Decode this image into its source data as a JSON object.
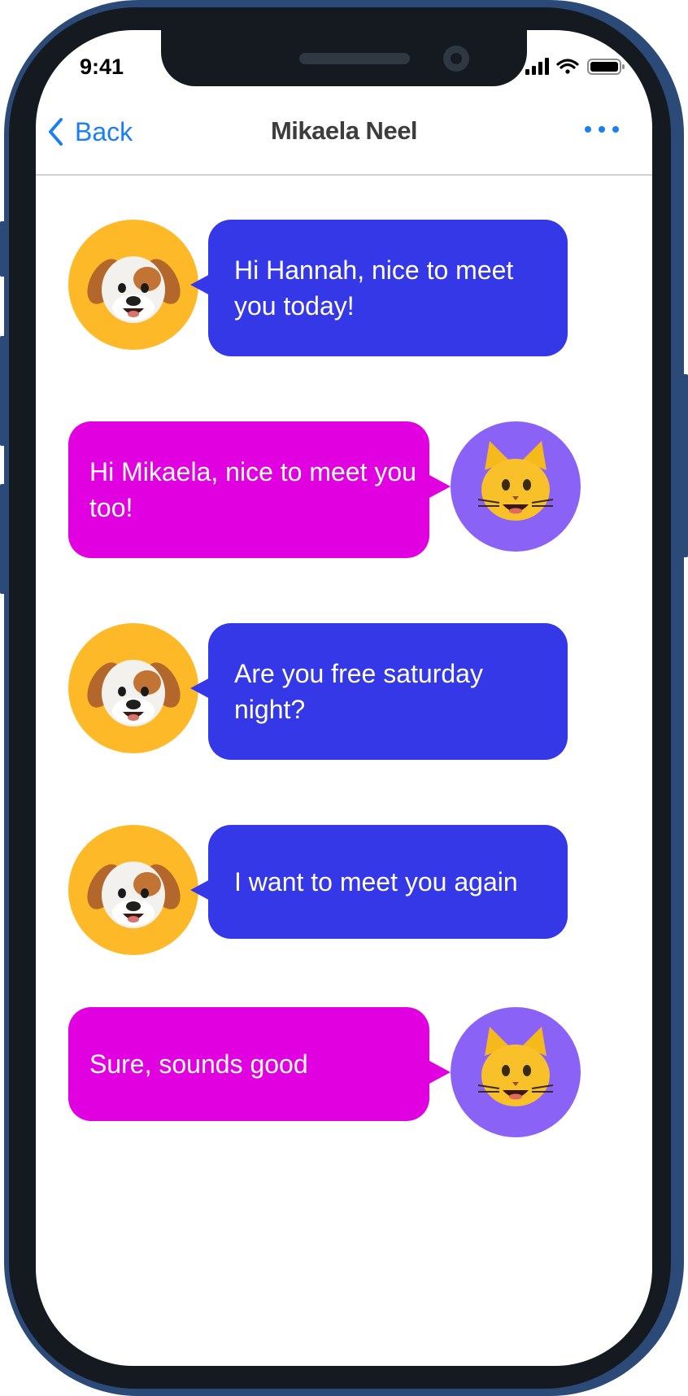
{
  "status_bar": {
    "time": "9:41"
  },
  "nav": {
    "back_label": "Back",
    "title": "Mikaela Neel"
  },
  "messages": [
    {
      "sender": "dog",
      "text": "Hi Hannah, nice to meet you today!"
    },
    {
      "sender": "cat",
      "text": "Hi Mikaela, nice to meet you too!"
    },
    {
      "sender": "dog",
      "text": "Are you free saturday night?"
    },
    {
      "sender": "dog",
      "text": "I want to meet you again"
    },
    {
      "sender": "cat",
      "text": "Sure, sounds good"
    }
  ],
  "avatars": {
    "dog": "dog-memoji-icon",
    "cat": "cat-memoji-icon"
  },
  "colors": {
    "accent": "#1a7ef5",
    "dog_bubble": "#3438e7",
    "cat_bubble": "#e000e0",
    "dog_avatar_bg": "#fdb927",
    "cat_avatar_bg": "#8a63f6",
    "frame": "#2b4a77"
  }
}
